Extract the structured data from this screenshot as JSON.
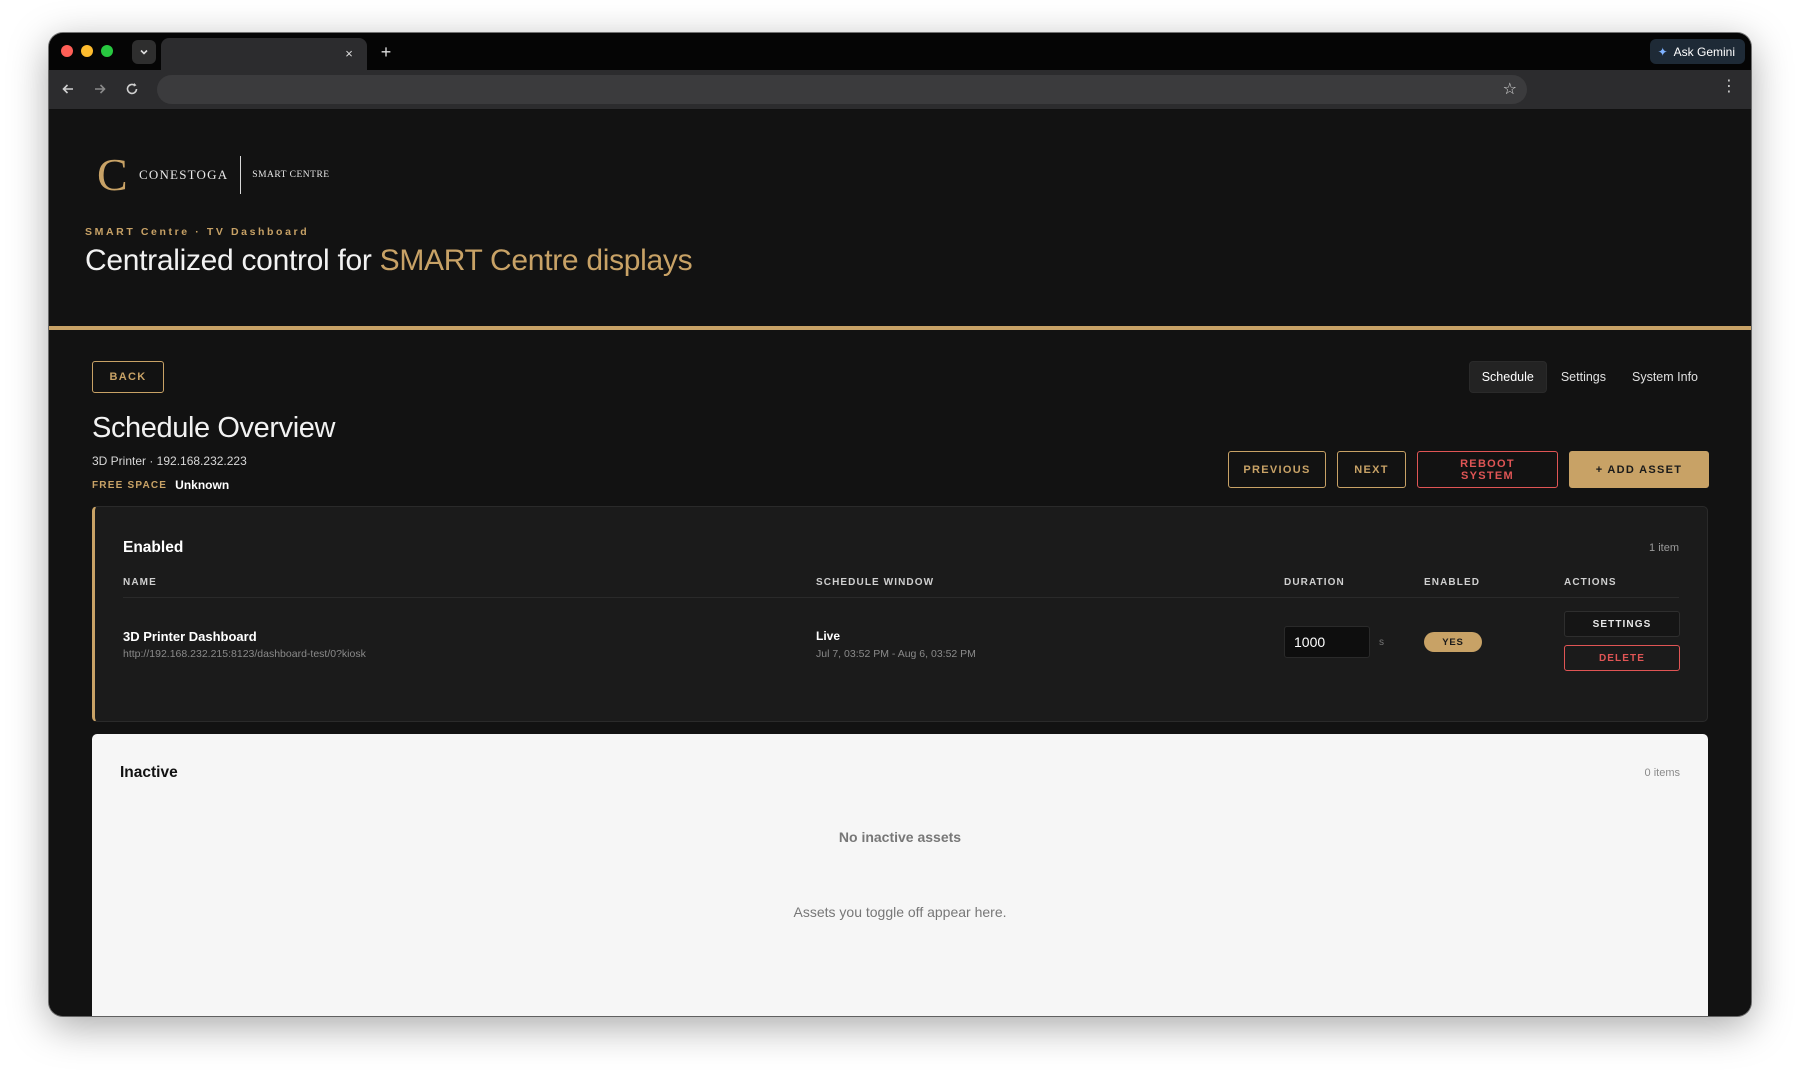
{
  "browser": {
    "tab_close": "×",
    "new_tab": "+",
    "ask_gemini": "Ask Gemini",
    "url": ""
  },
  "brand": {
    "logo_letter": "C",
    "logo_name": "CONESTOGA",
    "logo_sub": "SMART CENTRE"
  },
  "header": {
    "eyebrow": "SMART Centre · TV Dashboard",
    "title_prefix": "Centralized control for ",
    "title_accent": "SMART Centre displays"
  },
  "nav": {
    "back": "BACK",
    "tabs": [
      {
        "label": "Schedule",
        "active": true
      },
      {
        "label": "Settings",
        "active": false
      },
      {
        "label": "System Info",
        "active": false
      }
    ]
  },
  "overview": {
    "title": "Schedule Overview",
    "device": "3D Printer · 192.168.232.223",
    "free_space_label": "FREE SPACE",
    "free_space_value": "Unknown"
  },
  "actions": {
    "previous": "PREVIOUS",
    "next": "NEXT",
    "reboot": "REBOOT SYSTEM",
    "add_asset": "+ ADD ASSET"
  },
  "enabled_panel": {
    "title": "Enabled",
    "count": "1 item",
    "columns": [
      "NAME",
      "SCHEDULE WINDOW",
      "DURATION",
      "ENABLED",
      "ACTIONS"
    ],
    "rows": [
      {
        "name": "3D Printer Dashboard",
        "url": "http://192.168.232.215:8123/dashboard-test/0?kiosk",
        "status": "Live",
        "window": "Jul 7, 03:52 PM - Aug 6, 03:52 PM",
        "duration": "1000",
        "duration_unit": "s",
        "enabled": "YES",
        "settings_label": "SETTINGS",
        "delete_label": "DELETE"
      }
    ]
  },
  "inactive_panel": {
    "title": "Inactive",
    "count": "0 items",
    "empty_title": "No inactive assets",
    "empty_sub": "Assets you toggle off appear here."
  },
  "colors": {
    "accent_gold": "#c8a266",
    "danger_red": "#e05555",
    "page_bg": "#121212"
  }
}
